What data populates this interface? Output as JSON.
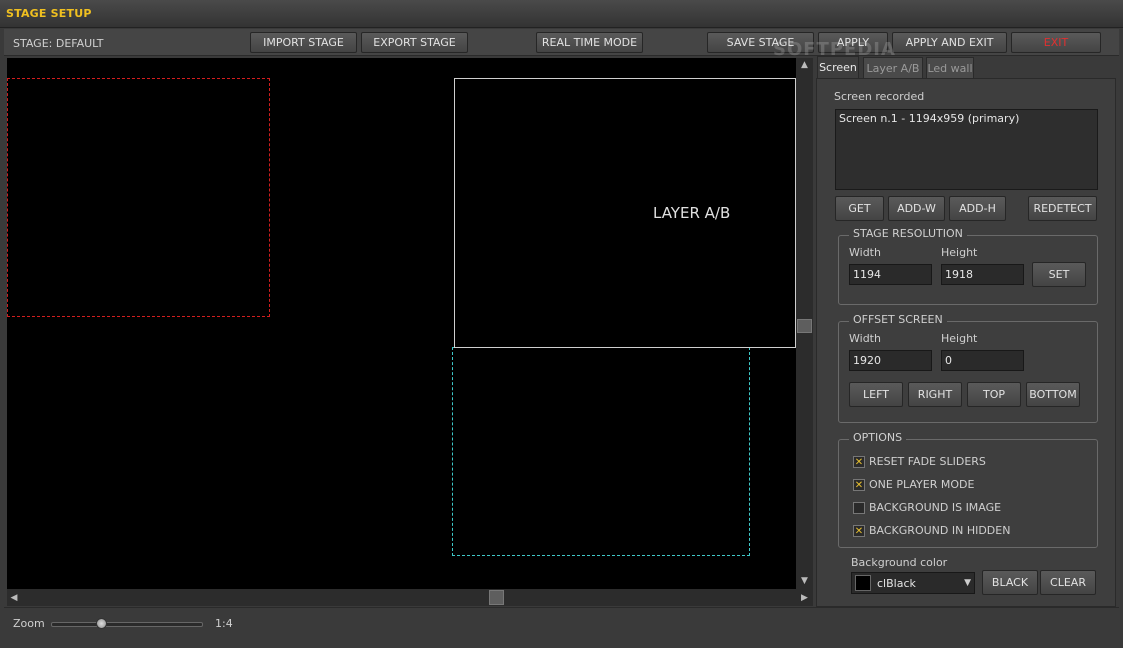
{
  "window": {
    "title": "STAGE SETUP"
  },
  "toolbar": {
    "stage_label": "STAGE: DEFAULT",
    "import": "IMPORT STAGE",
    "export": "EXPORT STAGE",
    "realtime": "REAL TIME MODE",
    "save": "SAVE STAGE",
    "apply": "APPLY",
    "apply_exit": "APPLY AND EXIT",
    "exit": "EXIT"
  },
  "canvas": {
    "layer_label": "LAYER A/B"
  },
  "tabs": [
    "Screen",
    "Layer A/B",
    "Led wall"
  ],
  "screen": {
    "recorded_label": "Screen recorded",
    "items": [
      "Screen n.1 - 1194x959 (primary)"
    ],
    "buttons": {
      "get": "GET",
      "add_w": "ADD-W",
      "add_h": "ADD-H",
      "redetect": "REDETECT"
    }
  },
  "stage_resolution": {
    "title": "STAGE RESOLUTION",
    "width_label": "Width",
    "height_label": "Height",
    "width": "1194",
    "height": "1918",
    "set": "SET"
  },
  "offset_screen": {
    "title": "OFFSET SCREEN",
    "width_label": "Width",
    "height_label": "Height",
    "width": "1920",
    "height": "0",
    "left": "LEFT",
    "right": "RIGHT",
    "top": "TOP",
    "bottom": "BOTTOM"
  },
  "options": {
    "title": "OPTIONS",
    "items": [
      {
        "label": "RESET FADE SLIDERS",
        "checked": true
      },
      {
        "label": "ONE PLAYER MODE",
        "checked": true
      },
      {
        "label": "BACKGROUND IS IMAGE",
        "checked": false
      },
      {
        "label": "BACKGROUND IN HIDDEN",
        "checked": true
      }
    ]
  },
  "background": {
    "label": "Background color",
    "value": "clBlack",
    "swatch": "#000000",
    "black": "BLACK",
    "clear": "CLEAR"
  },
  "zoom": {
    "label": "Zoom",
    "value": "1:4",
    "level": 0.33
  },
  "watermark": "SOFTPEDIA",
  "colors": {
    "title": "#f0c020",
    "exit": "#e03030",
    "red_region": "#d21e1e",
    "cyan_region": "#3fc8c8"
  }
}
